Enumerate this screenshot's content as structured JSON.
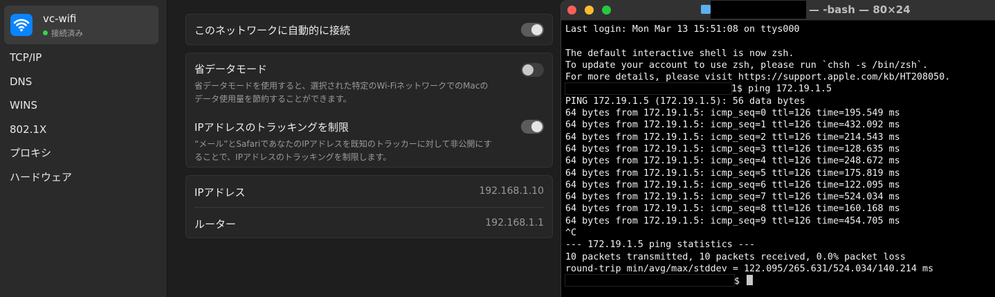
{
  "sidebar": {
    "network": {
      "name": "vc-wifi",
      "status": "接続済み"
    },
    "items": [
      "TCP/IP",
      "DNS",
      "WINS",
      "802.1X",
      "プロキシ",
      "ハードウェア"
    ]
  },
  "settings": {
    "auto_join": {
      "label": "このネットワークに自動的に接続",
      "enabled": true
    },
    "low_data": {
      "label": "省データモード",
      "desc1": "省データモードを使用すると、選択された特定のWi-FiネットワークでのMacの",
      "desc2": "データ使用量を節約することができます。",
      "enabled": false
    },
    "limit_tracking": {
      "label": "IPアドレスのトラッキングを制限",
      "desc1": "“メール”とSafariであなたのIPアドレスを既知のトラッカーに対して非公開にす",
      "desc2": "ることで、IPアドレスのトラッキングを制限します。",
      "enabled": true
    },
    "ip_address": {
      "label": "IPアドレス",
      "value": "192.168.1.10"
    },
    "router": {
      "label": "ルーター",
      "value": "192.168.1.1"
    }
  },
  "terminal": {
    "title": "— -bash — 80×24",
    "lines": [
      "Last login: Mon Mar 13 15:51:08 on ttys000",
      "",
      "The default interactive shell is now zsh.",
      "To update your account to use zsh, please run `chsh -s /bin/zsh`.",
      "For more details, please visit https://support.apple.com/kb/HT208050.",
      "1$ ping 172.19.1.5",
      "PING 172.19.1.5 (172.19.1.5): 56 data bytes",
      "64 bytes from 172.19.1.5: icmp_seq=0 ttl=126 time=195.549 ms",
      "64 bytes from 172.19.1.5: icmp_seq=1 ttl=126 time=432.092 ms",
      "64 bytes from 172.19.1.5: icmp_seq=2 ttl=126 time=214.543 ms",
      "64 bytes from 172.19.1.5: icmp_seq=3 ttl=126 time=128.635 ms",
      "64 bytes from 172.19.1.5: icmp_seq=4 ttl=126 time=248.672 ms",
      "64 bytes from 172.19.1.5: icmp_seq=5 ttl=126 time=175.819 ms",
      "64 bytes from 172.19.1.5: icmp_seq=6 ttl=126 time=122.095 ms",
      "64 bytes from 172.19.1.5: icmp_seq=7 ttl=126 time=524.034 ms",
      "64 bytes from 172.19.1.5: icmp_seq=8 ttl=126 time=160.168 ms",
      "64 bytes from 172.19.1.5: icmp_seq=9 ttl=126 time=454.705 ms",
      "^C",
      "--- 172.19.1.5 ping statistics ---",
      "10 packets transmitted, 10 packets received, 0.0% packet loss",
      "round-trip min/avg/max/stddev = 122.095/265.631/524.034/140.214 ms",
      "$ "
    ]
  }
}
